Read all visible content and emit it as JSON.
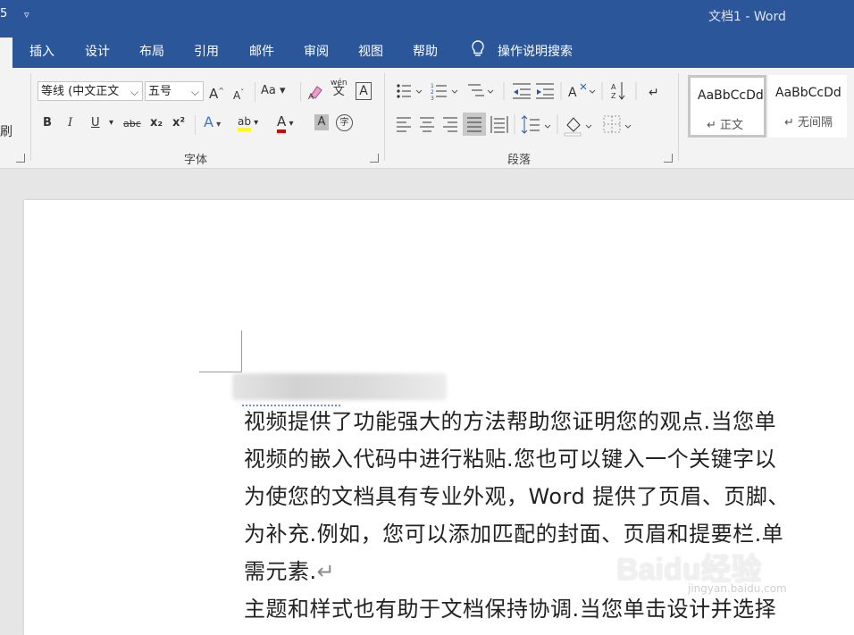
{
  "titlebar": {
    "quick_access_left": "5",
    "quick_access_caret": "▿",
    "title": "文档1  -  Word"
  },
  "tabs": [
    {
      "label": "插入"
    },
    {
      "label": "设计"
    },
    {
      "label": "布局"
    },
    {
      "label": "引用"
    },
    {
      "label": "邮件"
    },
    {
      "label": "审阅"
    },
    {
      "label": "视图"
    },
    {
      "label": "帮助"
    }
  ],
  "tell_me": "操作说明搜索",
  "ribbon": {
    "clipboard_partial": "刷",
    "font": {
      "font_name": "等线 (中文正文",
      "font_size": "五号",
      "grow": "A",
      "shrink": "A",
      "change_case": "Aa",
      "bold": "B",
      "italic": "I",
      "underline": "U",
      "strikethrough": "abc",
      "subscript": "x₂",
      "superscript": "x²",
      "phonetic": "wén",
      "phonetic_char": "文",
      "char_border": "A",
      "text_effects": "A",
      "highlight": "ab",
      "font_color": "A",
      "char_shading": "A",
      "enclose": "字",
      "group_label": "字体"
    },
    "paragraph": {
      "group_label": "段落"
    },
    "styles": [
      {
        "sample": "AaBbCcDd",
        "name": "正文"
      },
      {
        "sample": "AaBbCcDd",
        "name": "无间隔"
      }
    ]
  },
  "document": {
    "lines": [
      "视频提供了功能强大的方法帮助您证明您的观点.当您单",
      "视频的嵌入代码中进行粘贴.您也可以键入一个关键字以",
      "为使您的文档具有专业外观，Word 提供了页眉、页脚、",
      "为补充.例如，您可以添加匹配的封面、页眉和提要栏.单",
      "需元素.",
      "主题和样式也有助于文档保持协调.当您单击设计并选择"
    ],
    "paragraph_mark": "↵"
  },
  "watermark": {
    "brand": "Baidu经验",
    "sub": "jingyan.baidu.com"
  },
  "colors": {
    "ribbon_blue": "#2b579a",
    "highlight_yellow": "#ffff00",
    "font_red": "#e00000"
  }
}
